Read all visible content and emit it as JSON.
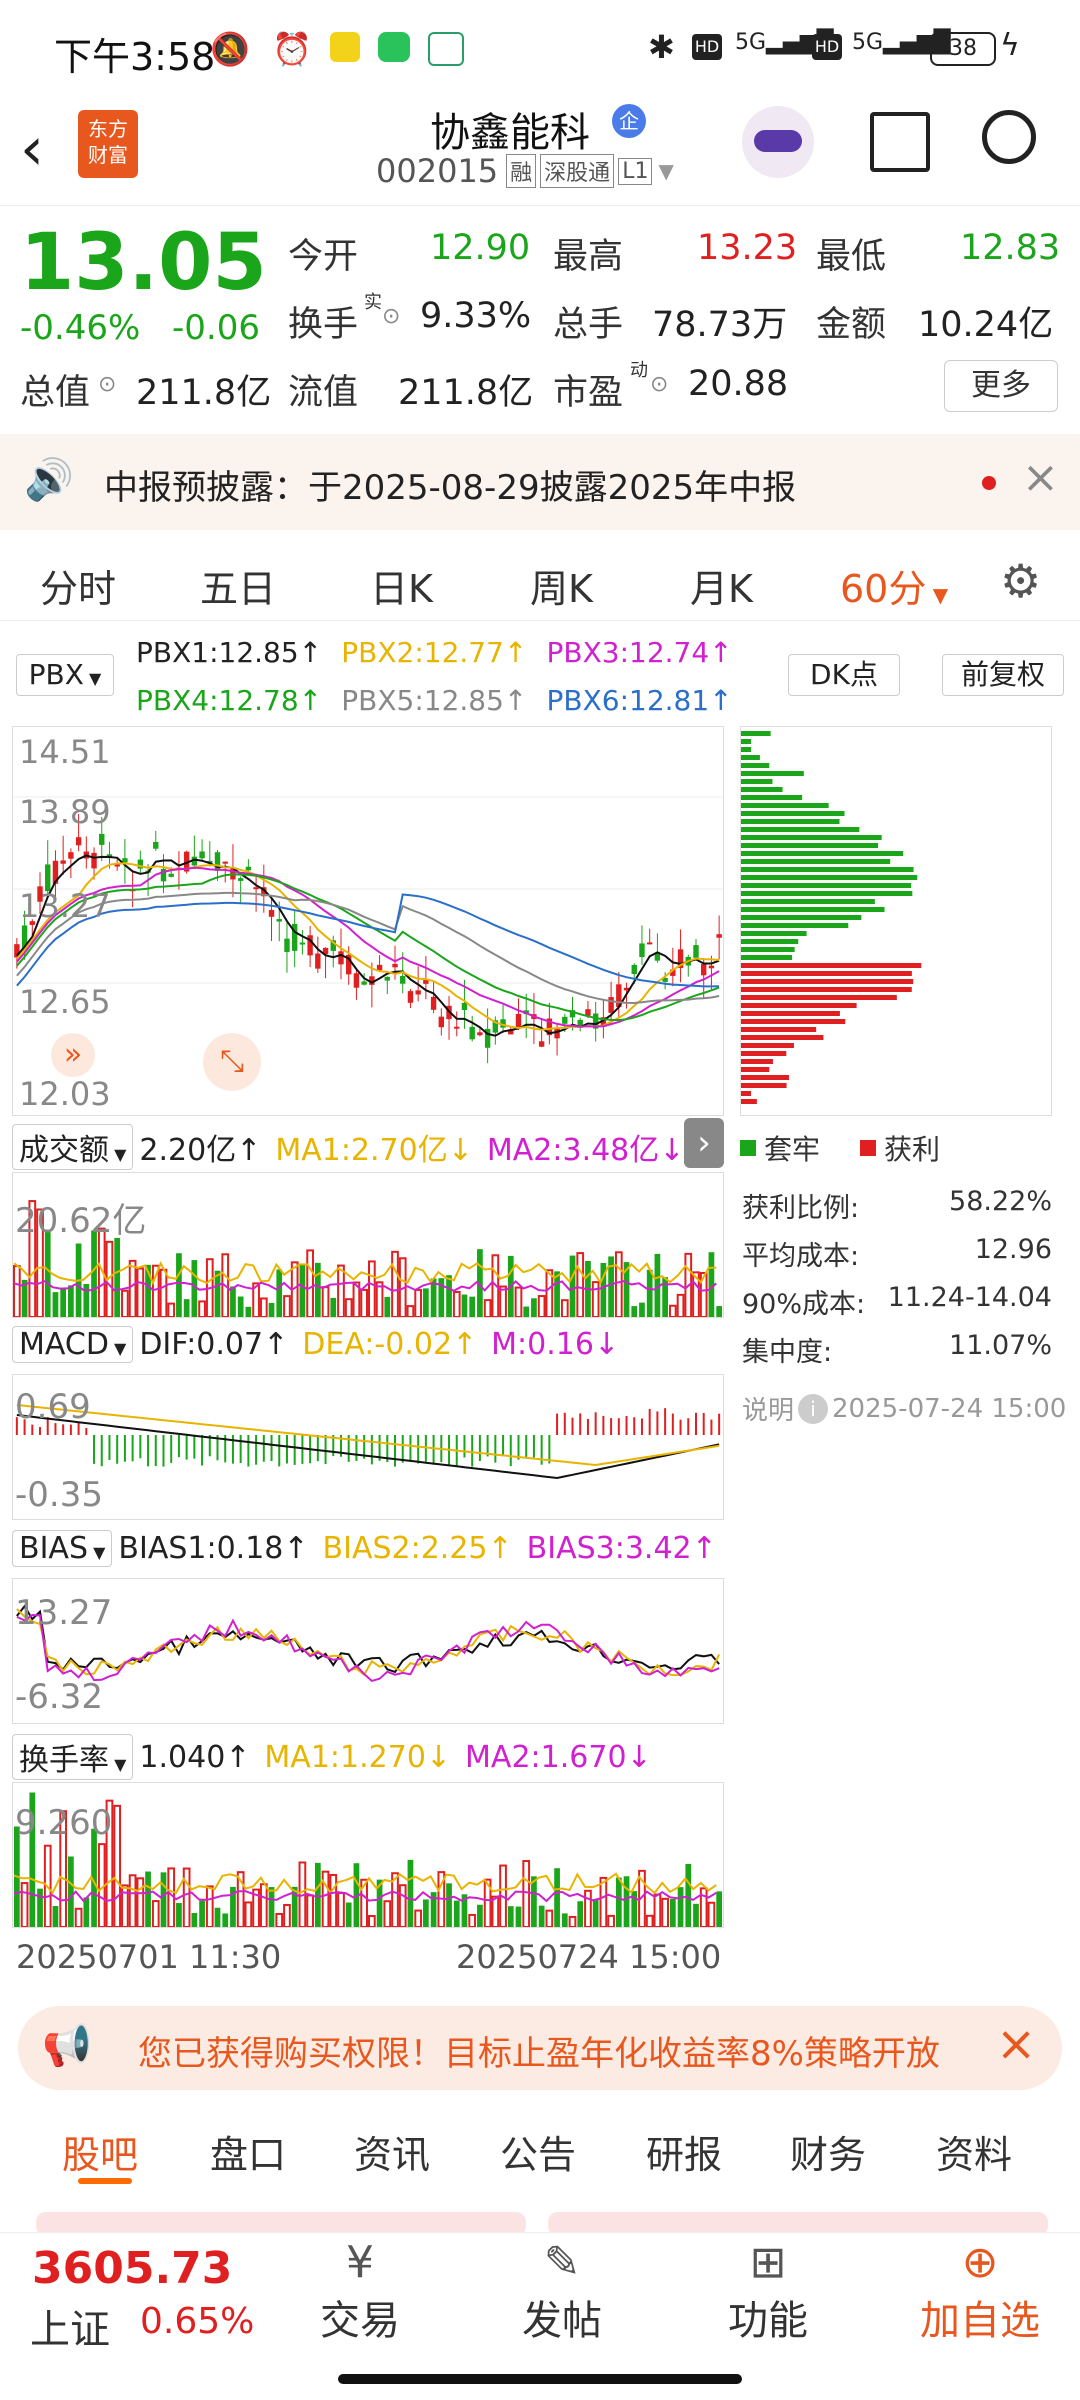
{
  "status": {
    "time": "下午3:58",
    "battery": "38"
  },
  "header": {
    "title": "协鑫能科",
    "code": "002015",
    "tags": [
      "融",
      "深股通",
      "L1"
    ],
    "badge": "企",
    "logo_line1": "东方",
    "logo_line2": "财富"
  },
  "quote": {
    "price": "13.05",
    "change_pct": "-0.46%",
    "change": "-0.06",
    "open_label": "今开",
    "open": "12.90",
    "high_label": "最高",
    "high": "13.23",
    "low_label": "最低",
    "low": "12.83",
    "turnover_label": "换手",
    "turnover_sup": "实",
    "turnover": "9.33%",
    "volume_label": "总手",
    "volume": "78.73万",
    "amount_label": "金额",
    "amount": "10.24亿",
    "mktcap_label": "总值",
    "mktcap": "211.8亿",
    "float_label": "流值",
    "float": "211.8亿",
    "pe_label": "市盈",
    "pe_sup": "动",
    "pe": "20.88",
    "more": "更多"
  },
  "notice": {
    "text": "中报预披露：于2025-08-29披露2025年中报"
  },
  "chart_tabs": [
    "分时",
    "五日",
    "日K",
    "周K",
    "月K",
    "60分"
  ],
  "main_chart": {
    "indicator": "PBX",
    "pbx1": "PBX1:12.85↑",
    "pbx2": "PBX2:12.77↑",
    "pbx3": "PBX3:12.74↑",
    "pbx4": "PBX4:12.78↑",
    "pbx5": "PBX5:12.85↑",
    "pbx6": "PBX6:12.81↑",
    "dk": "DK点",
    "adjust": "前复权",
    "y_labels": [
      "14.51",
      "13.89",
      "13.27",
      "12.65",
      "12.03"
    ]
  },
  "chip": {
    "legend_trapped": "套牢",
    "legend_profit": "获利",
    "rows": [
      {
        "label": "获利比例:",
        "value": "58.22%"
      },
      {
        "label": "平均成本:",
        "value": "12.96"
      },
      {
        "label": "90%成本:",
        "value": "11.24-14.04"
      },
      {
        "label": "集中度:",
        "value": "11.07%"
      }
    ],
    "note_label": "说明",
    "note_date": "2025-07-24 15:00"
  },
  "volume_panel": {
    "name": "成交额",
    "value": "2.20亿↑",
    "ma1": "MA1:2.70亿↓",
    "ma2": "MA2:3.48亿↓",
    "max_label": "20.62亿"
  },
  "macd_panel": {
    "name": "MACD",
    "dif": "DIF:0.07↑",
    "dea": "DEA:-0.02↑",
    "m": "M:0.16↓",
    "top": "0.69",
    "bottom": "-0.35"
  },
  "bias_panel": {
    "name": "BIAS",
    "b1": "BIAS1:0.18↑",
    "b2": "BIAS2:2.25↑",
    "b3": "BIAS3:3.42↑",
    "top": "13.27",
    "bottom": "-6.32"
  },
  "turn_panel": {
    "name": "换手率",
    "value": "1.040↑",
    "ma1": "MA1:1.270↓",
    "ma2": "MA2:1.670↓",
    "max_label": "9.260"
  },
  "x_axis": {
    "start": "20250701 11:30",
    "end": "20250724 15:00"
  },
  "ad": {
    "text": "您已获得购买权限！目标止盈年化收益率8%策略开放"
  },
  "bottom_tabs": [
    "股吧",
    "盘口",
    "资讯",
    "公告",
    "研报",
    "财务",
    "资料"
  ],
  "bottom_nav": {
    "index_value": "3605.73",
    "index_name": "上证",
    "index_change": "0.65%",
    "trade": "交易",
    "post": "发帖",
    "func": "功能",
    "add": "加自选"
  },
  "colors": {
    "up": "#e02020",
    "down": "#1aa51a",
    "accent": "#ff6a00",
    "pbx2": "#e8b400",
    "pbx3": "#d020d0",
    "pbx6": "#2a6fc9"
  }
}
